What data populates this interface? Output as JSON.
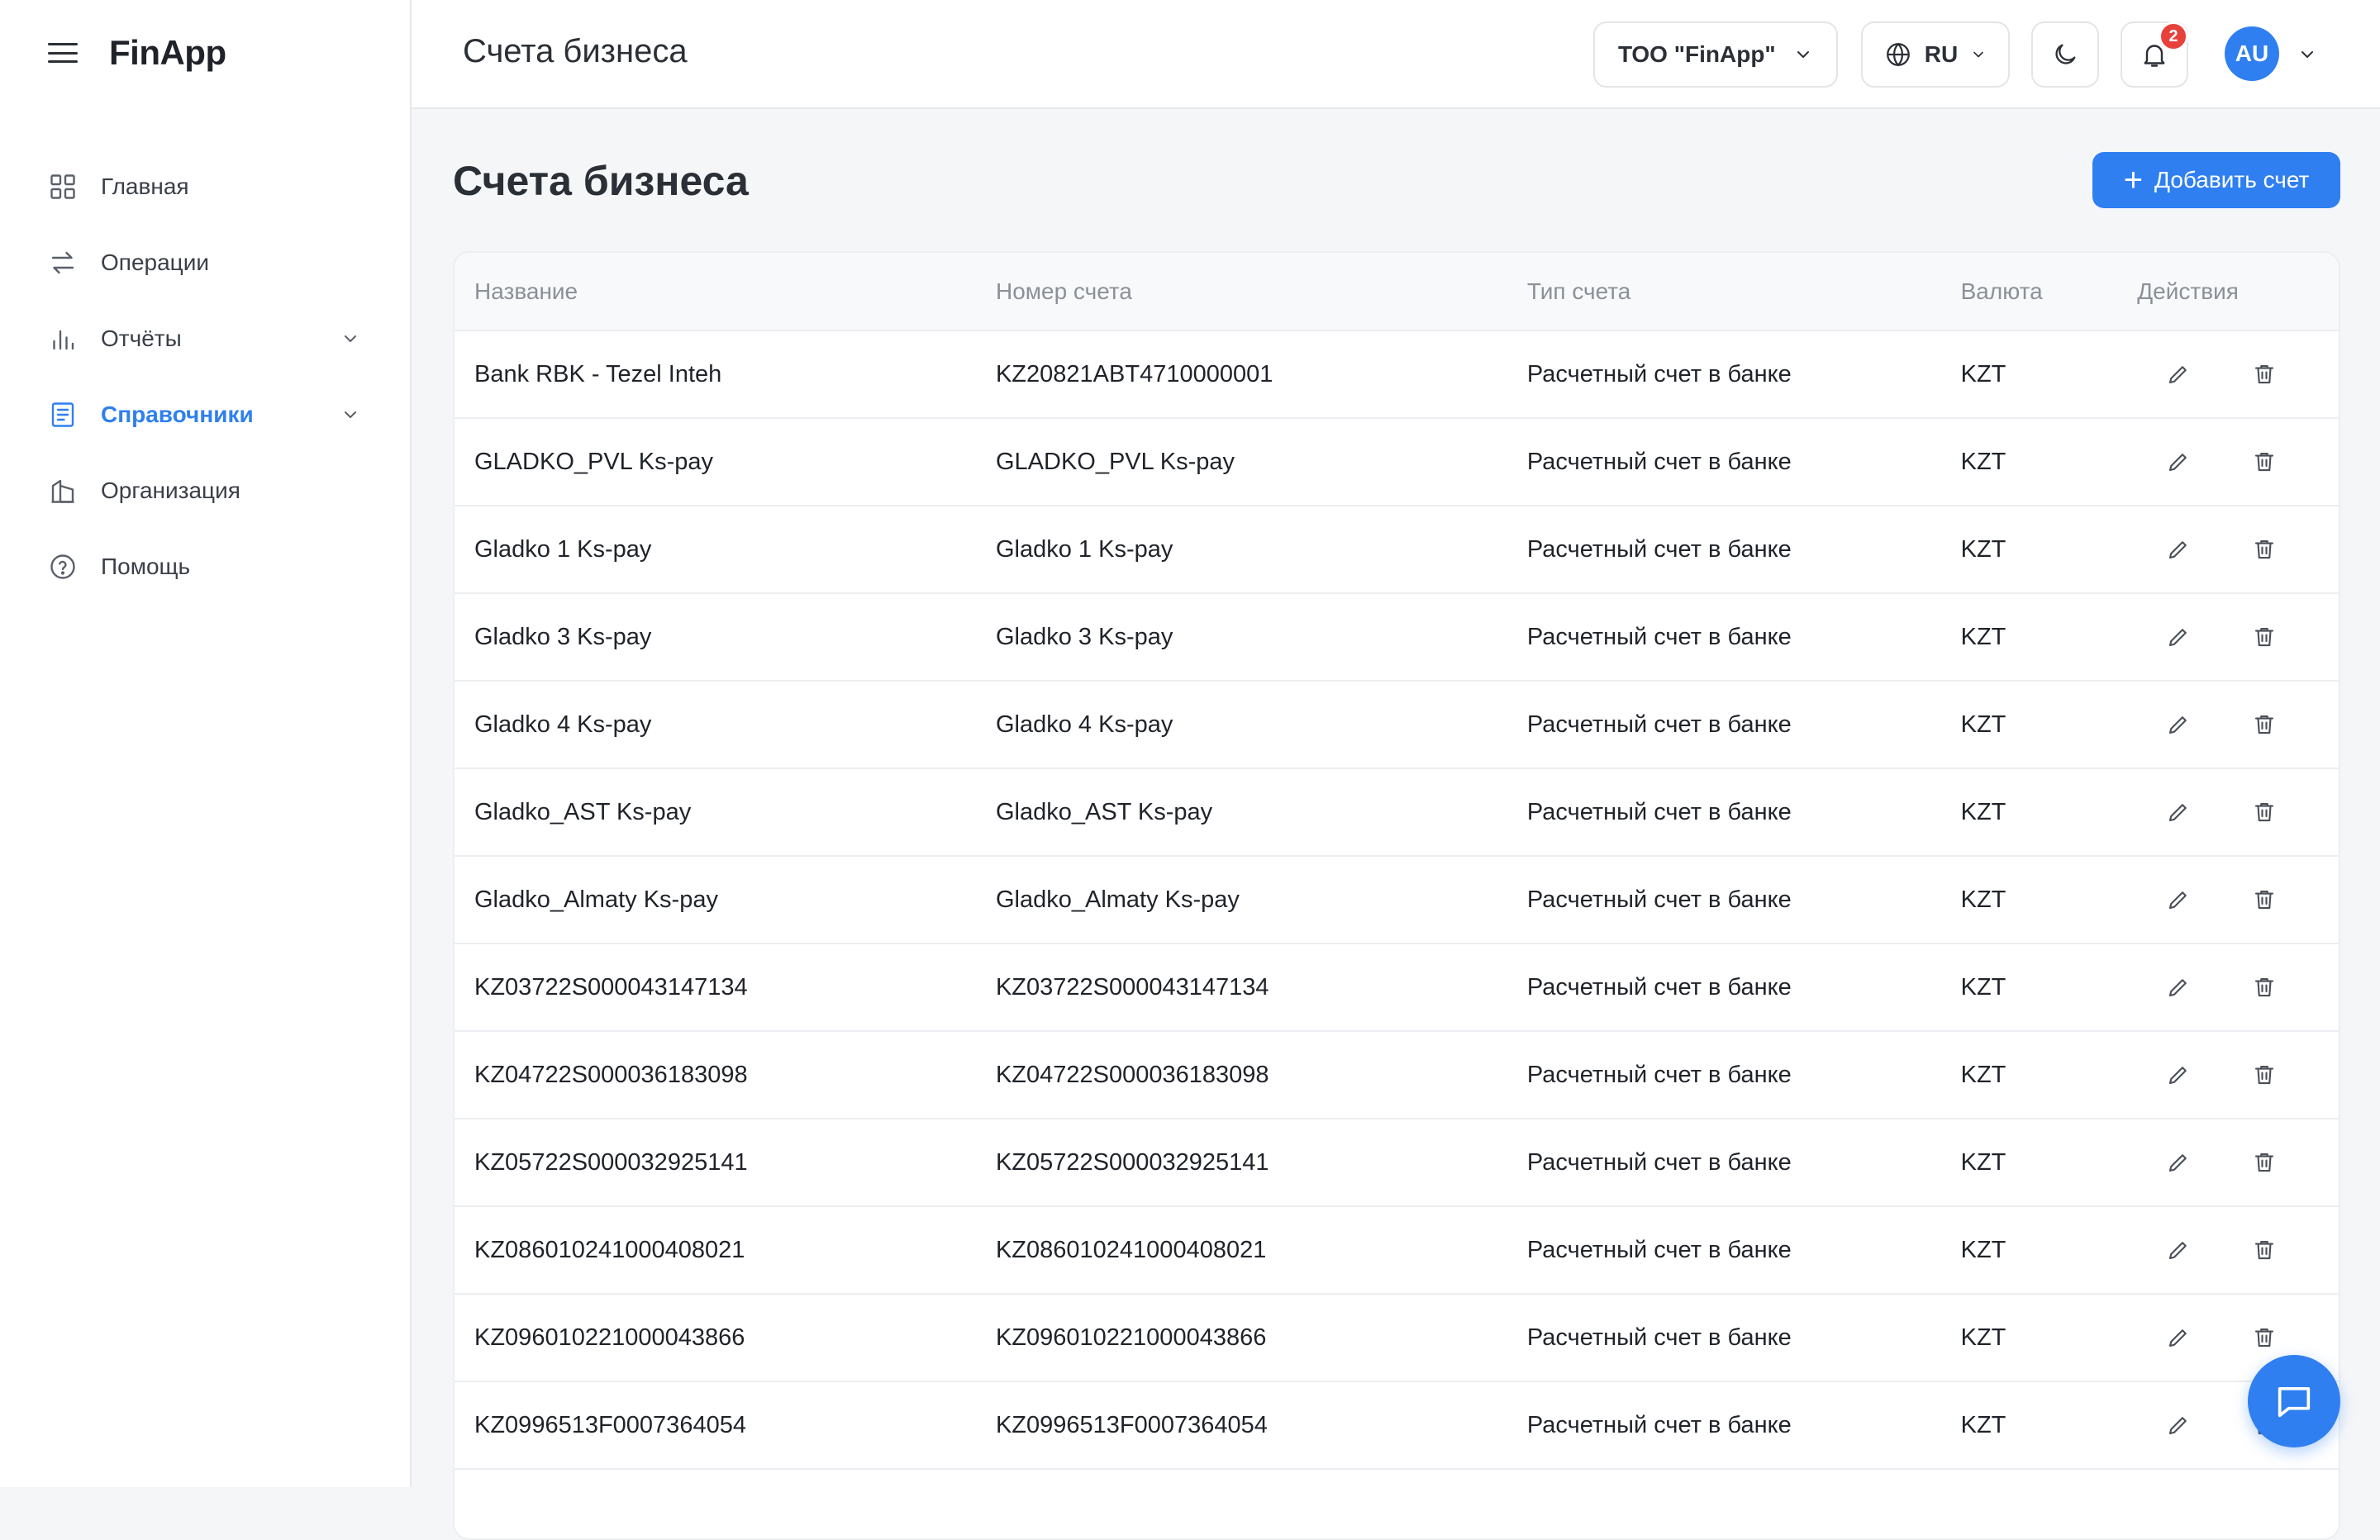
{
  "app": {
    "logo": "FinApp"
  },
  "sidebar": {
    "items": [
      {
        "label": "Главная",
        "icon": "grid-icon"
      },
      {
        "label": "Операции",
        "icon": "transfer-arrows-icon"
      },
      {
        "label": "Отчёты",
        "icon": "bar-chart-icon",
        "expandable": true
      },
      {
        "label": "Справочники",
        "icon": "book-icon",
        "expandable": true,
        "active": true
      },
      {
        "label": "Организация",
        "icon": "building-icon"
      },
      {
        "label": "Помощь",
        "icon": "help-circle-icon"
      }
    ]
  },
  "header": {
    "title": "Счета бизнеса",
    "org_selector": "ТОО \"FinApp\"",
    "language": "RU",
    "notifications_count": "2",
    "avatar_initials": "AU"
  },
  "main": {
    "title": "Счета бизнеса",
    "add_button_label": "Добавить счет",
    "table": {
      "headers": [
        "Название",
        "Номер счета",
        "Тип счета",
        "Валюта",
        "Действия"
      ],
      "rows": [
        {
          "name": "Bank RBK - Tezel Inteh",
          "number": "KZ20821ABT4710000001",
          "type": "Расчетный счет в банке",
          "currency": "KZT"
        },
        {
          "name": "GLADKO_PVL Ks-pay",
          "number": "GLADKO_PVL Ks-pay",
          "type": "Расчетный счет в банке",
          "currency": "KZT"
        },
        {
          "name": "Gladko 1 Ks-pay",
          "number": "Gladko 1 Ks-pay",
          "type": "Расчетный счет в банке",
          "currency": "KZT"
        },
        {
          "name": "Gladko 3 Ks-pay",
          "number": "Gladko 3 Ks-pay",
          "type": "Расчетный счет в банке",
          "currency": "KZT"
        },
        {
          "name": "Gladko 4 Ks-pay",
          "number": "Gladko 4 Ks-pay",
          "type": "Расчетный счет в банке",
          "currency": "KZT"
        },
        {
          "name": "Gladko_AST Ks-pay",
          "number": "Gladko_AST Ks-pay",
          "type": "Расчетный счет в банке",
          "currency": "KZT"
        },
        {
          "name": "Gladko_Almaty Ks-pay",
          "number": "Gladko_Almaty Ks-pay",
          "type": "Расчетный счет в банке",
          "currency": "KZT"
        },
        {
          "name": "KZ03722S000043147134",
          "number": "KZ03722S000043147134",
          "type": "Расчетный счет в банке",
          "currency": "KZT"
        },
        {
          "name": "KZ04722S000036183098",
          "number": "KZ04722S000036183098",
          "type": "Расчетный счет в банке",
          "currency": "KZT"
        },
        {
          "name": "KZ05722S000032925141",
          "number": "KZ05722S000032925141",
          "type": "Расчетный счет в банке",
          "currency": "KZT"
        },
        {
          "name": "KZ086010241000408021",
          "number": "KZ086010241000408021",
          "type": "Расчетный счет в банке",
          "currency": "KZT"
        },
        {
          "name": "KZ096010221000043866",
          "number": "KZ096010221000043866",
          "type": "Расчетный счет в банке",
          "currency": "KZT"
        },
        {
          "name": "KZ0996513F0007364054",
          "number": "KZ0996513F0007364054",
          "type": "Расчетный счет в банке",
          "currency": "KZT"
        }
      ]
    }
  },
  "colors": {
    "accent": "#2f7ff0",
    "badge": "#e8403b",
    "text": "#1f2329",
    "muted": "#8b9098"
  }
}
